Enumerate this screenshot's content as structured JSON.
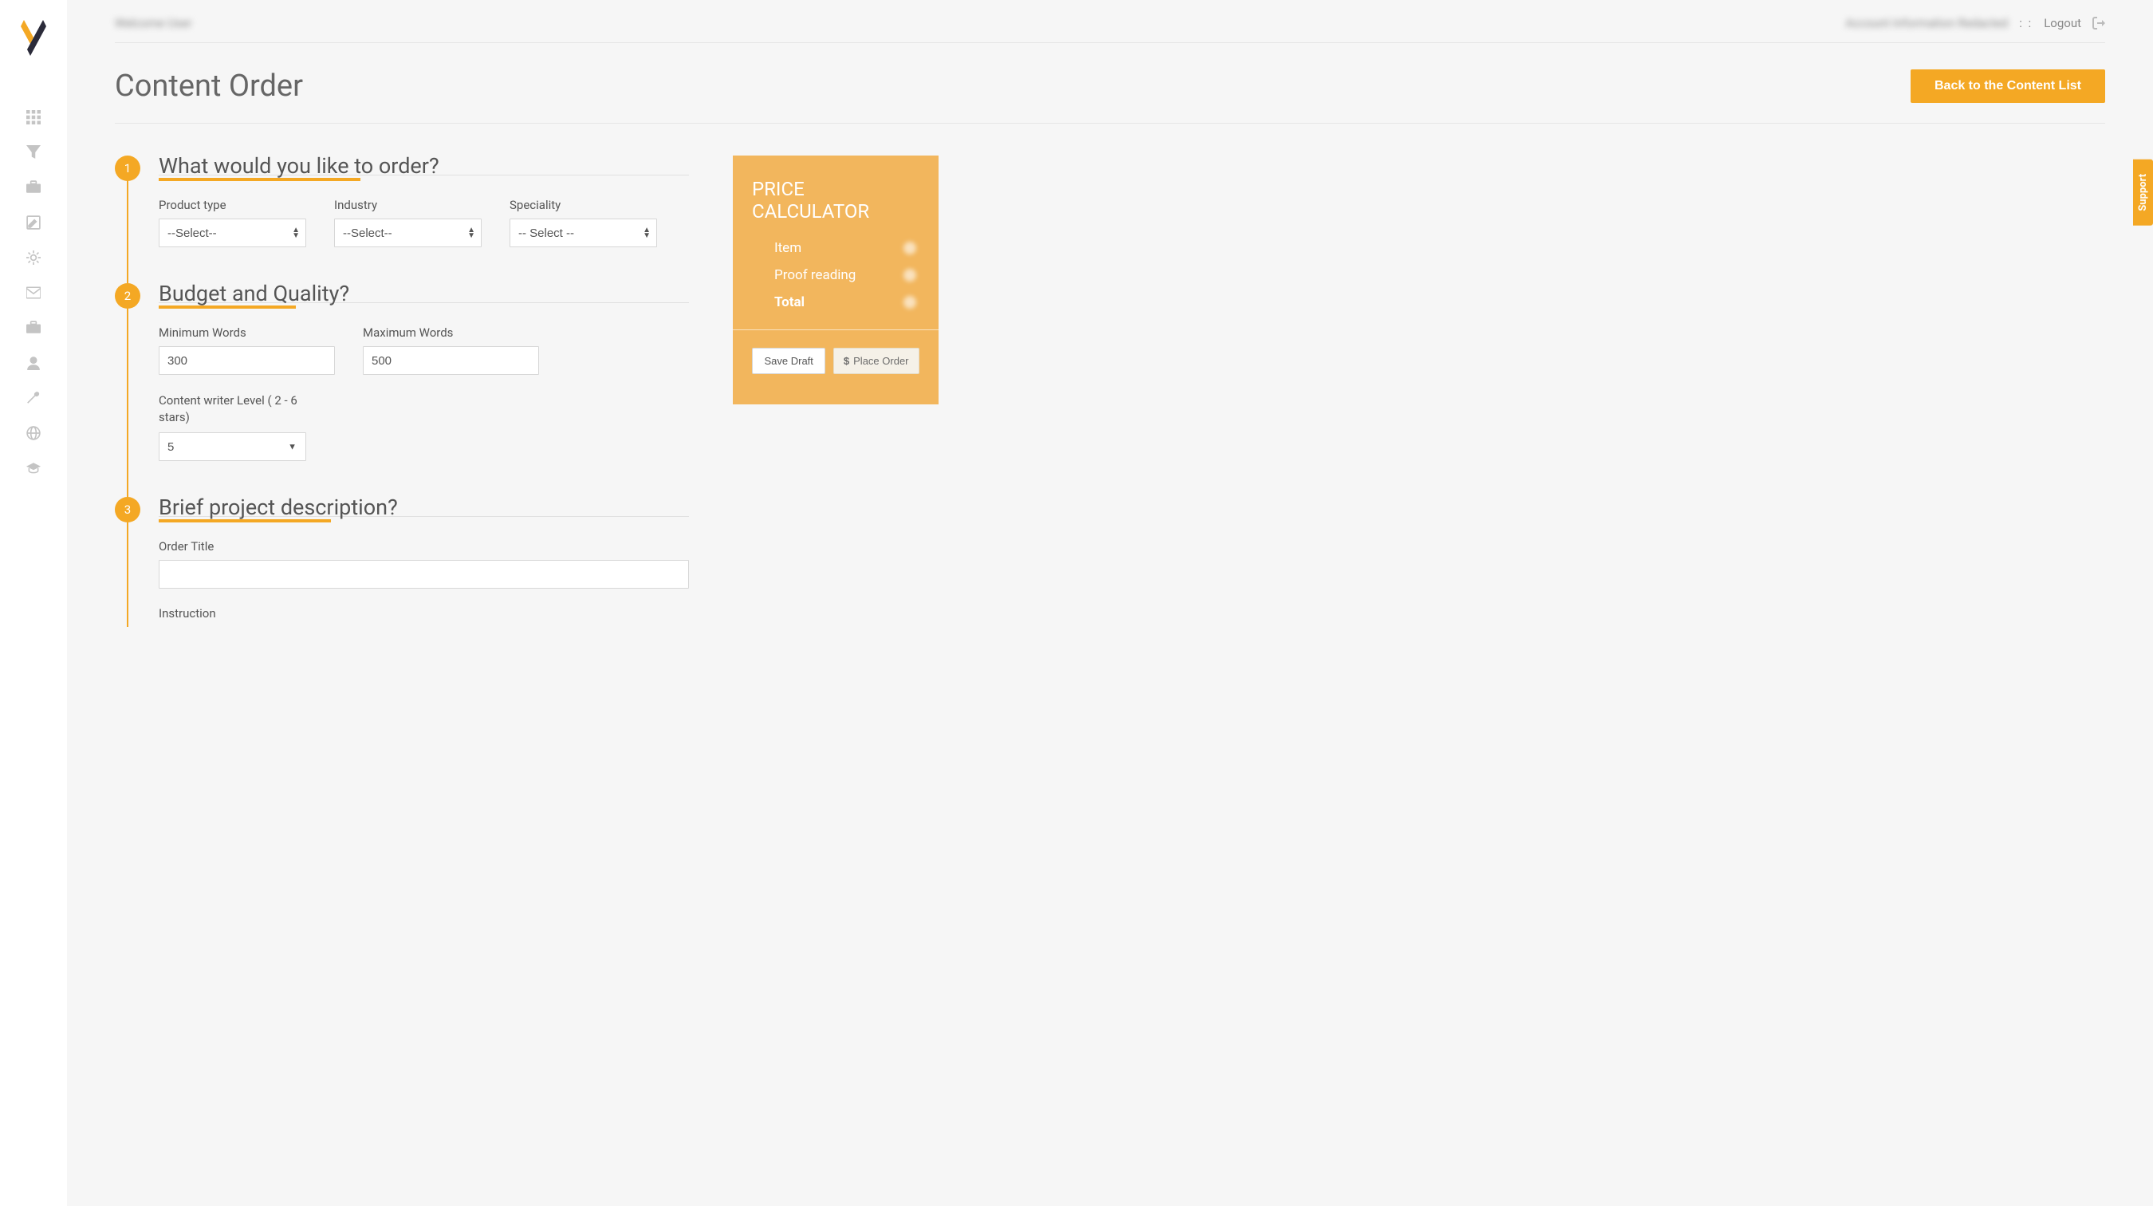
{
  "colors": {
    "accent": "#f4a824",
    "accent_light": "#f2b65d"
  },
  "topbar": {
    "greeting": "Welcome User",
    "account": "Account Information Redacted",
    "colons": ": :",
    "logout": "Logout"
  },
  "page": {
    "title": "Content Order",
    "back_button": "Back to the Content List"
  },
  "steps": [
    {
      "num": "1",
      "title": "What would you like to order?",
      "fields": {
        "product_type": {
          "label": "Product type",
          "value": "--Select--"
        },
        "industry": {
          "label": "Industry",
          "value": "--Select--"
        },
        "speciality": {
          "label": "Speciality",
          "value": "-- Select --"
        }
      }
    },
    {
      "num": "2",
      "title": "Budget and Quality?",
      "fields": {
        "min_words": {
          "label": "Minimum Words",
          "value": "300"
        },
        "max_words": {
          "label": "Maximum Words",
          "value": "500"
        },
        "writer_level": {
          "label": "Content writer Level ( 2 - 6 stars)",
          "value": "5"
        }
      }
    },
    {
      "num": "3",
      "title": "Brief project description?",
      "fields": {
        "order_title": {
          "label": "Order Title",
          "value": ""
        },
        "instruction": {
          "label": "Instruction"
        }
      }
    }
  ],
  "calc": {
    "title": "PRICE CALCULATOR",
    "item_label": "Item",
    "proof_label": "Proof reading",
    "total_label": "Total",
    "save_draft": "Save Draft",
    "place_order": "Place Order"
  },
  "support_tab": "Support"
}
